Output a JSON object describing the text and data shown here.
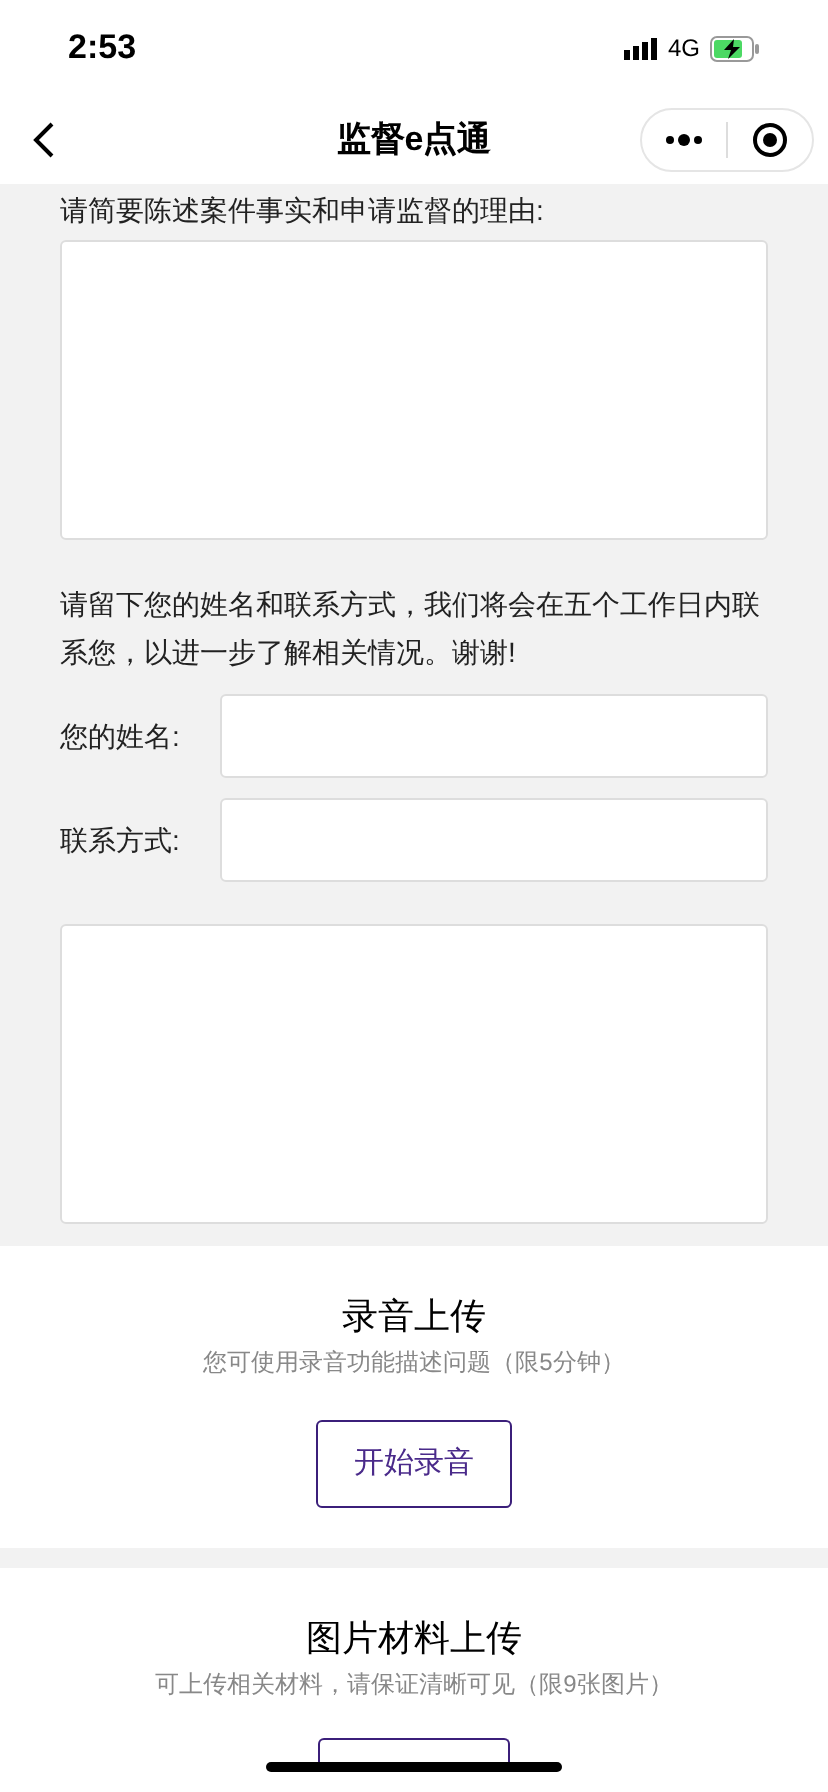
{
  "status_bar": {
    "time": "2:53",
    "network": "4G"
  },
  "nav": {
    "title": "监督e点通"
  },
  "form": {
    "reason_label": "请简要陈述案件事实和申请监督的理由:",
    "contact_note": "请留下您的姓名和联系方式，我们将会在五个工作日内联系您，以进一步了解相关情况。谢谢!",
    "fields": [
      {
        "label": "您的姓名:"
      },
      {
        "label": "联系方式:"
      }
    ]
  },
  "sections": [
    {
      "title": "录音上传",
      "subtitle": "您可使用录音功能描述问题（限5分钟）",
      "button": "开始录音"
    },
    {
      "title": "图片材料上传",
      "subtitle": "可上传相关材料，请保证清晰可见（限9张图片）"
    }
  ]
}
